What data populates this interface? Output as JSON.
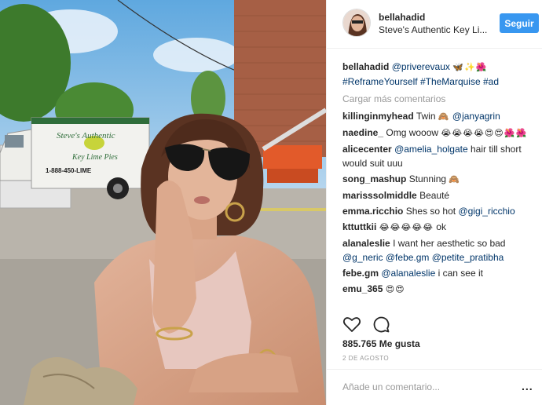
{
  "post": {
    "username": "bellahadid",
    "location": "Steve's Authentic Key Li...",
    "follow_label": "Seguir",
    "avatar_icon": "profile-avatar",
    "photo_sign": {
      "line1": "Steve's Authentic",
      "line2": "Key Lime Pies",
      "phone": "1-888-450-LIME"
    },
    "caption": {
      "user": "bellahadid",
      "mention": "@priverevaux",
      "emojis": "🦋✨🌺",
      "hashtags": "#ReframeYourself #TheMarquise #ad"
    },
    "load_more": "Cargar más comentarios",
    "comments": [
      {
        "user": "killinginmyhead",
        "text": "Twin",
        "emoji": "🙈",
        "mention": "@janyagrin"
      },
      {
        "user": "naedine_",
        "text": "Omg wooow",
        "emoji": "😭😭😭😭😍😍🌺🌺"
      },
      {
        "user": "alicecenter",
        "mention": "@amelia_holgate",
        "text": "hair till short would suit uuu"
      },
      {
        "user": "song_mashup",
        "text": "Stunning",
        "emoji": "🙈"
      },
      {
        "user": "marisssolmiddle",
        "text": "Beauté"
      },
      {
        "user": "emma.ricchio",
        "text": "Shes so hot",
        "mention": "@gigi_ricchio"
      },
      {
        "user": "kttuttkii",
        "emoji": "😂😂😂😂😂",
        "text": "ok"
      },
      {
        "user": "alanaleslie",
        "text": "I want her aesthetic so bad",
        "mention": "@g_neric @febe.gm @petite_pratibha"
      },
      {
        "user": "febe.gm",
        "mention": "@alanaleslie",
        "text": "i can see it"
      },
      {
        "user": "emu_365",
        "emoji": "😍😍"
      }
    ],
    "actions": {
      "like_icon": "heart-icon",
      "comment_icon": "comment-icon"
    },
    "likes": "885.765 Me gusta",
    "date": "2 DE AGOSTO",
    "add_comment_placeholder": "Añade un comentario...",
    "more_options": "..."
  }
}
